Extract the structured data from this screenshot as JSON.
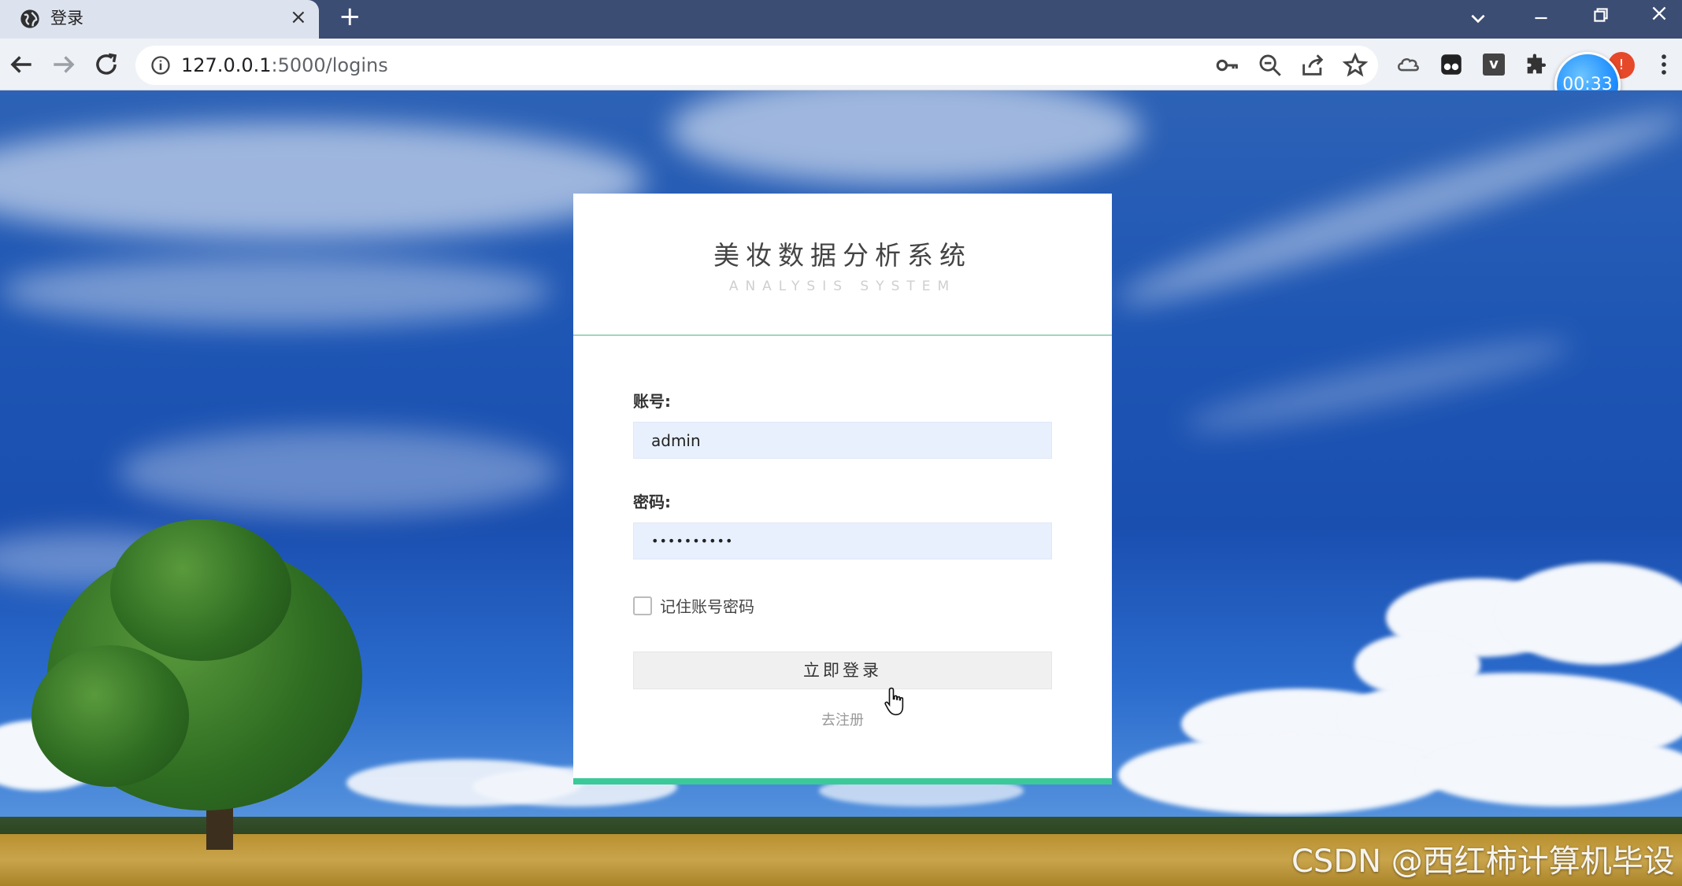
{
  "browser": {
    "tab_title": "登录",
    "new_tab_symbol": "+",
    "tab_close_symbol": "×",
    "url_host": "127.0.0.1",
    "url_rest": ":5000/logins",
    "extension_v_label": "v",
    "timer_label": "00:33",
    "profile_label": "!"
  },
  "login": {
    "title": "美妆数据分析系统",
    "subtitle": "ANALYSIS SYSTEM",
    "username_label": "账号:",
    "username_value": "admin",
    "password_label": "密码:",
    "password_value": "••••••••••",
    "remember_label": "记住账号密码",
    "remember_checked": false,
    "login_button": "立即登录",
    "register_link": "去注册"
  },
  "watermark": "CSDN @西红柿计算机毕设",
  "colors": {
    "accent_green": "#3cc99a",
    "input_bg": "#e8f0fe",
    "chrome_dark": "#3c4d73",
    "timer_blue": "#1f8fff"
  },
  "icons": {
    "back": "arrow-left-icon",
    "forward": "arrow-right-icon",
    "reload": "reload-icon",
    "info": "info-icon",
    "key": "key-icon",
    "zoom": "zoom-out-icon",
    "share": "share-icon",
    "bookmark": "star-icon",
    "extensions": "puzzle-icon",
    "menu": "kebab-menu-icon"
  }
}
